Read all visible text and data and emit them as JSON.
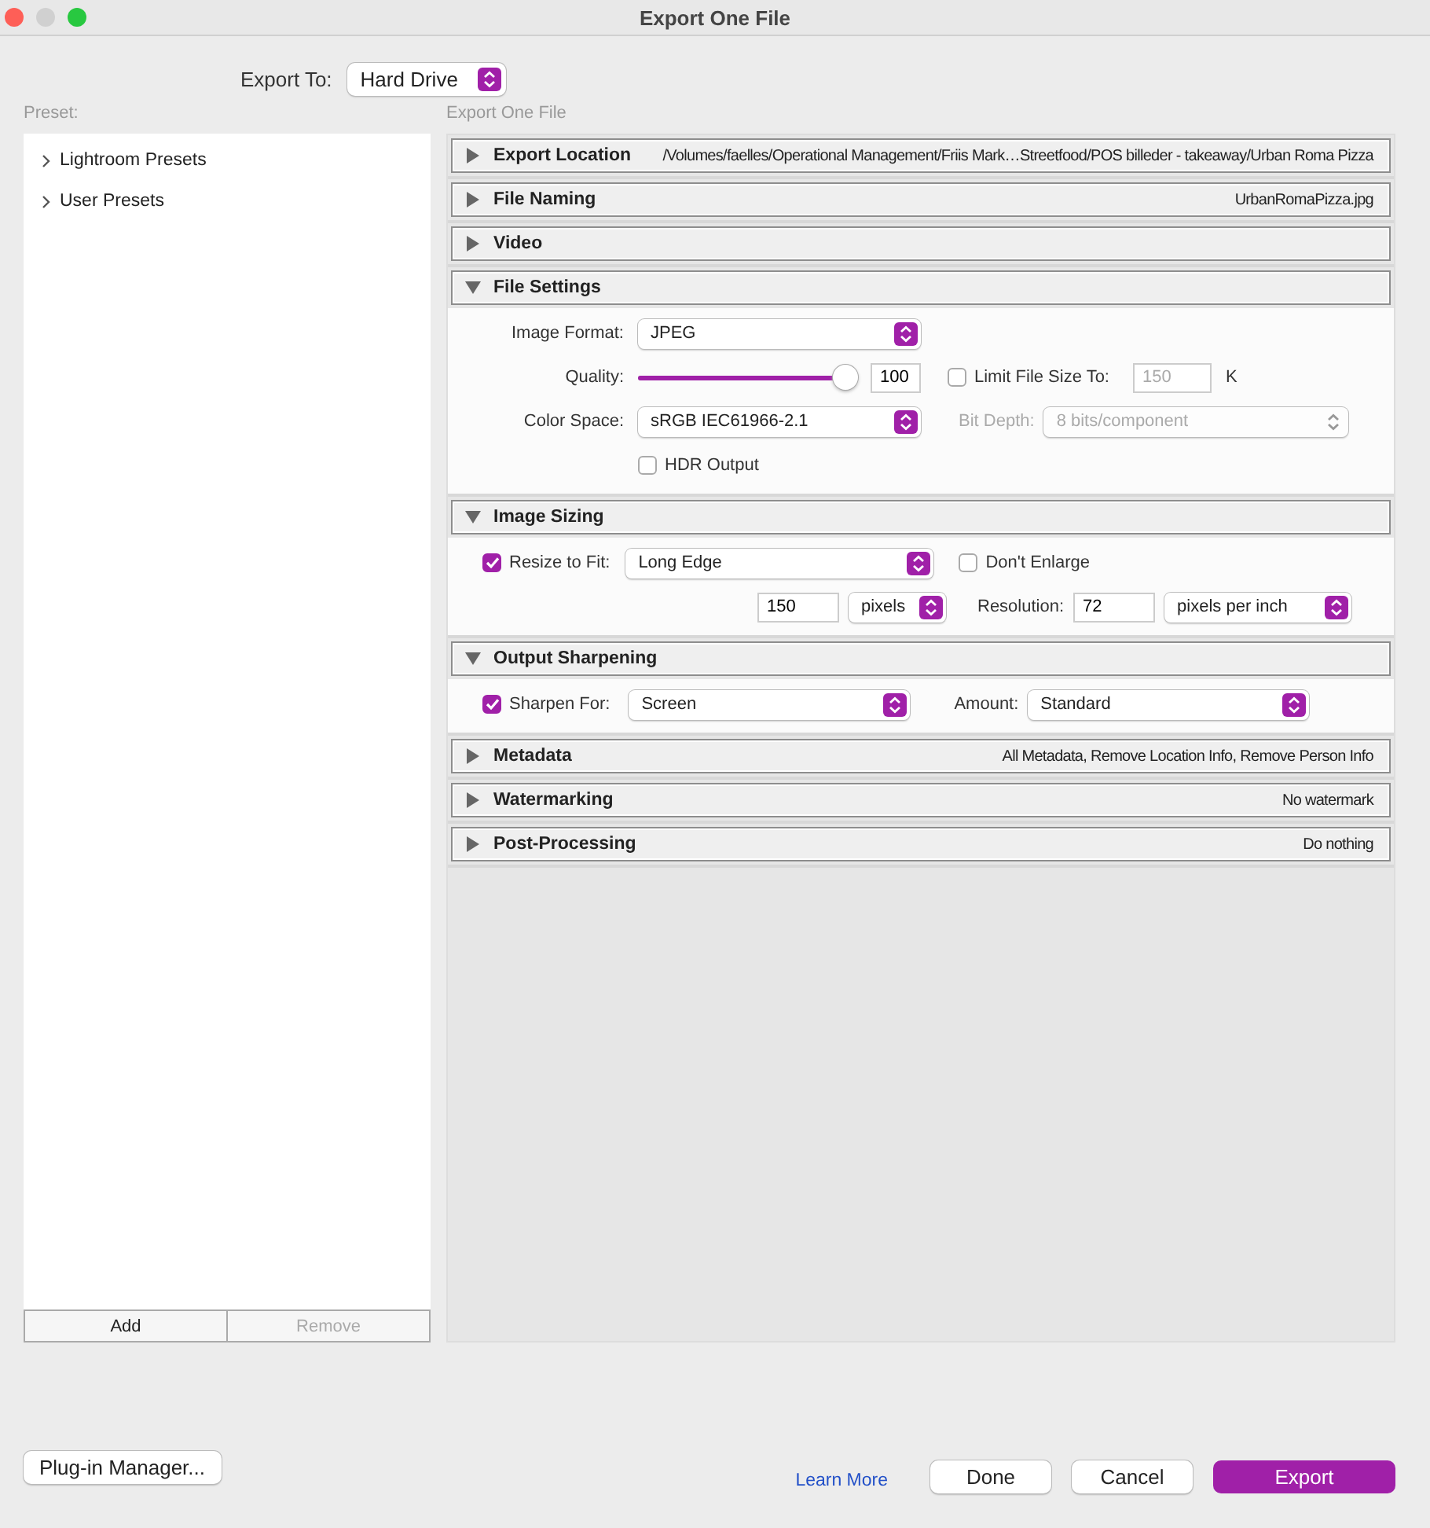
{
  "window": {
    "title": "Export One File"
  },
  "export_to": {
    "label": "Export To:",
    "value": "Hard Drive"
  },
  "preset_panel": {
    "label": "Preset:",
    "items": [
      {
        "label": "Lightroom Presets",
        "expanded": false
      },
      {
        "label": "User Presets",
        "expanded": false
      }
    ],
    "buttons": [
      {
        "label": "Add",
        "disabled": false
      },
      {
        "label": "Remove",
        "disabled": true
      }
    ]
  },
  "sections_label": "Export One File",
  "sections": [
    {
      "kind": "summary",
      "title": "Export Location",
      "expanded": false,
      "summary": "/Volumes/faelles/Operational Management/Friis Mark…Streetfood/POS billeder - takeaway/Urban Roma Pizza"
    },
    {
      "kind": "summary",
      "title": "File Naming",
      "expanded": false,
      "summary": "UrbanRomaPizza.jpg"
    },
    {
      "kind": "summary",
      "title": "Video",
      "expanded": false
    },
    {
      "kind": "file_settings",
      "title": "File Settings",
      "expanded": true,
      "image_format": {
        "label": "Image Format:",
        "value": "JPEG"
      },
      "quality": {
        "label": "Quality:",
        "level": 1,
        "value": "100"
      },
      "limit_file_size": {
        "label": "Limit File Size To:",
        "checked": false,
        "value": "150",
        "unit": "K",
        "disabled": true
      },
      "color_space": {
        "label": "Color Space:",
        "value": "sRGB IEC61966-2.1"
      },
      "bit_depth": {
        "label": "Bit Depth:",
        "value": "8 bits/component",
        "disabled": true
      },
      "hdr_output": {
        "label": "HDR Output",
        "checked": false
      }
    },
    {
      "kind": "image_sizing",
      "title": "Image Sizing",
      "expanded": true,
      "resize_to_fit": {
        "label": "Resize to Fit:",
        "checked": true,
        "value": "Long Edge"
      },
      "dont_enlarge": {
        "label": "Don't Enlarge",
        "checked": false
      },
      "size": {
        "value": "150",
        "unit": "pixels"
      },
      "resolution": {
        "label": "Resolution:",
        "value": "72",
        "unit": "pixels per inch"
      }
    },
    {
      "kind": "output_sharpening",
      "title": "Output Sharpening",
      "expanded": true,
      "sharpen_for": {
        "label": "Sharpen For:",
        "checked": true,
        "value": "Screen"
      },
      "amount": {
        "label": "Amount:",
        "value": "Standard"
      }
    },
    {
      "kind": "summary",
      "title": "Metadata",
      "expanded": false,
      "summary": "All Metadata, Remove Location Info, Remove Person Info"
    },
    {
      "kind": "summary",
      "title": "Watermarking",
      "expanded": false,
      "summary": "No watermark"
    },
    {
      "kind": "summary",
      "title": "Post-Processing",
      "expanded": false,
      "summary": "Do nothing"
    }
  ],
  "footer": {
    "plugin_manager": "Plug-in Manager...",
    "learn_more": "Learn More",
    "buttons": [
      {
        "label": "Done",
        "kind": "default"
      },
      {
        "label": "Cancel",
        "kind": "default"
      },
      {
        "label": "Export",
        "kind": "primary"
      }
    ]
  }
}
